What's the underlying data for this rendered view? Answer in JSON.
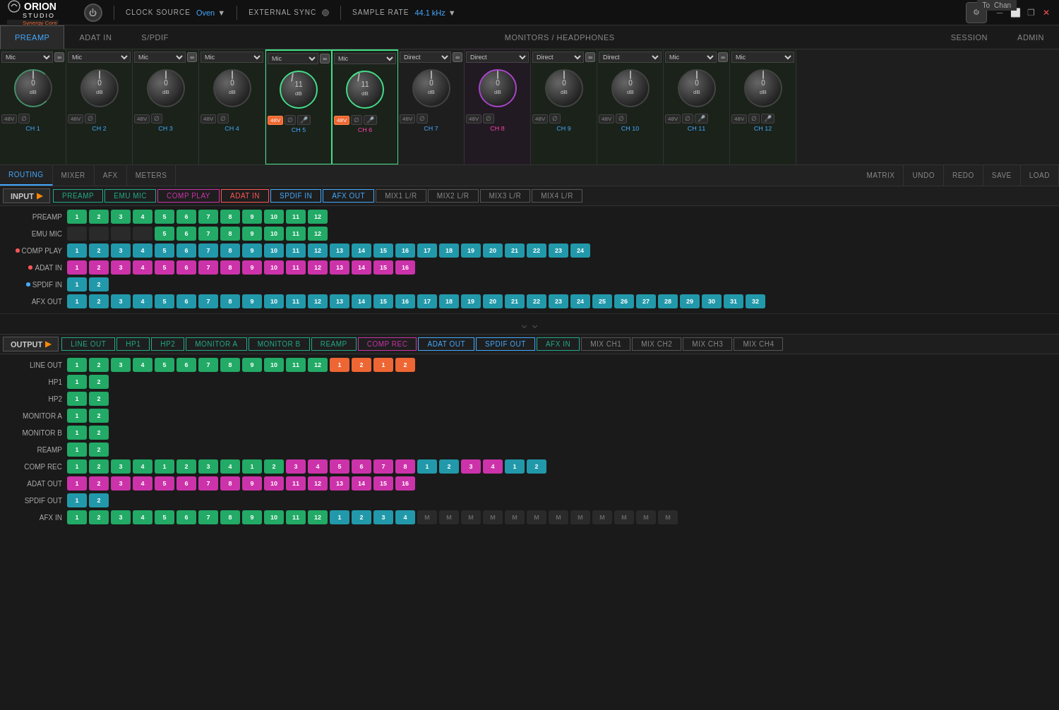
{
  "app": {
    "title": "ORION STUDIO",
    "subtitle": "Synergy Core",
    "power": "⏻",
    "clock_source_label": "CLOCK SOURCE",
    "clock_source_value": "Oven",
    "external_sync_label": "EXTERNAL SYNC",
    "sample_rate_label": "SAMPLE RATE",
    "sample_rate_value": "44.1 kHz"
  },
  "title_tabs": [
    {
      "id": "preamp",
      "label": "PREAMP",
      "active": true
    },
    {
      "id": "adat_in",
      "label": "ADAT IN"
    },
    {
      "id": "spdif",
      "label": "S/PDIF"
    },
    {
      "id": "monitors",
      "label": "MONITORS / HEADPHONES",
      "wide": true
    },
    {
      "id": "session",
      "label": "SESSION"
    },
    {
      "id": "admin",
      "label": "ADMIN"
    }
  ],
  "channels": [
    {
      "id": "ch1",
      "label": "CH 1",
      "type": "input",
      "source": "Mic",
      "db": "0",
      "linked": true,
      "phantom": true,
      "phase": true,
      "color": "green"
    },
    {
      "id": "ch2",
      "label": "CH 2",
      "type": "input",
      "source": "Mic",
      "db": "0",
      "linked": false,
      "phantom": true,
      "phase": true,
      "color": "green"
    },
    {
      "id": "ch3",
      "label": "CH 3",
      "type": "input",
      "source": "Mic",
      "db": "0",
      "linked": true,
      "phantom": true,
      "phase": true,
      "color": "green"
    },
    {
      "id": "ch4",
      "label": "CH 4",
      "type": "input",
      "source": "Mic",
      "db": "0",
      "linked": false,
      "phantom": true,
      "phase": true,
      "color": "green"
    },
    {
      "id": "ch5",
      "label": "CH 5",
      "type": "input",
      "source": "Mic",
      "db": "11",
      "linked": true,
      "phantom": true,
      "phantom_active": true,
      "phase": true,
      "color": "green"
    },
    {
      "id": "ch6",
      "label": "CH 6",
      "type": "input",
      "source": "Mic",
      "db": "11",
      "linked": false,
      "phantom": true,
      "phantom_active": true,
      "phase": true,
      "color": "green"
    },
    {
      "id": "ch7",
      "label": "CH 7",
      "type": "input",
      "source": "Direct",
      "db": "0",
      "linked": true,
      "phantom": true,
      "phase": true,
      "color": "green"
    },
    {
      "id": "ch8",
      "label": "CH 8",
      "type": "input",
      "source": "Direct",
      "db": "0",
      "linked": false,
      "phantom": true,
      "phase": true,
      "color": "pink"
    },
    {
      "id": "ch9",
      "label": "CH 9",
      "type": "input",
      "source": "Direct",
      "db": "0",
      "linked": true,
      "phantom": true,
      "phase": true,
      "color": "green"
    },
    {
      "id": "ch10",
      "label": "CH 10",
      "type": "input",
      "source": "Direct",
      "db": "0",
      "linked": false,
      "phantom": true,
      "phase": true,
      "color": "green"
    },
    {
      "id": "ch11",
      "label": "CH 11",
      "type": "input",
      "source": "Mic",
      "db": "0",
      "linked": true,
      "phantom": true,
      "phase": true,
      "color": "green"
    },
    {
      "id": "ch12",
      "label": "CH 12",
      "type": "input",
      "source": "Mic",
      "db": "0",
      "linked": false,
      "phantom": true,
      "phase": true,
      "color": "green"
    }
  ],
  "nav_tabs": [
    {
      "id": "routing",
      "label": "ROUTING",
      "active": true
    },
    {
      "id": "mixer",
      "label": "MIXER"
    },
    {
      "id": "afx",
      "label": "AFX"
    },
    {
      "id": "meters",
      "label": "METERS"
    }
  ],
  "nav_actions": [
    {
      "id": "matrix",
      "label": "MATRIX"
    },
    {
      "id": "undo",
      "label": "UNDO"
    },
    {
      "id": "redo",
      "label": "REDO"
    },
    {
      "id": "save",
      "label": "SAVE"
    },
    {
      "id": "load",
      "label": "LOAD"
    }
  ],
  "input_label": "INPUT",
  "input_columns": [
    {
      "id": "preamp",
      "label": "PREAMP",
      "color": "green"
    },
    {
      "id": "emu_mic",
      "label": "EMU MIC",
      "color": "green"
    },
    {
      "id": "comp_play",
      "label": "COMP PLAY",
      "color": "pink"
    },
    {
      "id": "adat_in",
      "label": "ADAT IN",
      "color": "red"
    },
    {
      "id": "spdif_in",
      "label": "SPDIF IN",
      "color": "cyan"
    },
    {
      "id": "afx_out",
      "label": "AFX OUT",
      "color": "cyan"
    },
    {
      "id": "mix1lr",
      "label": "MIX1 L/R",
      "color": "gray"
    },
    {
      "id": "mix2lr",
      "label": "MIX2 L/R",
      "color": "gray"
    },
    {
      "id": "mix3lr",
      "label": "MIX3 L/R",
      "color": "gray"
    },
    {
      "id": "mix4lr",
      "label": "MIX4 L/R",
      "color": "gray"
    }
  ],
  "input_rows": [
    {
      "label": "PREAMP",
      "has_dot": false,
      "groups": [
        {
          "color": "green",
          "cells": [
            1,
            2,
            3,
            4,
            5,
            6,
            7,
            8,
            9,
            10,
            11,
            12
          ]
        }
      ]
    },
    {
      "label": "EMU MIC",
      "has_dot": false,
      "groups": [
        {
          "color": "none",
          "cells": [
            null,
            null,
            null,
            null
          ]
        },
        {
          "color": "green",
          "cells": [
            5,
            6,
            7,
            8,
            9,
            10,
            11,
            12
          ]
        }
      ]
    },
    {
      "label": "COMP PLAY",
      "has_dot": true,
      "dot_color": "red",
      "groups": [
        {
          "color": "cyan",
          "cells": [
            1,
            2,
            3,
            4,
            5,
            6,
            7,
            8,
            9,
            10,
            11,
            12,
            13,
            14,
            15,
            16,
            17,
            18,
            19,
            20,
            21,
            22,
            23,
            24
          ]
        }
      ]
    },
    {
      "label": "ADAT IN",
      "has_dot": true,
      "dot_color": "red",
      "groups": [
        {
          "color": "pink",
          "cells": [
            1,
            2,
            3,
            4,
            5,
            6,
            7,
            8,
            9,
            10,
            11,
            12,
            13,
            14,
            15,
            16
          ]
        }
      ]
    },
    {
      "label": "SPDIF IN",
      "has_dot": true,
      "dot_color": "cyan",
      "groups": [
        {
          "color": "cyan",
          "cells": [
            1,
            2
          ]
        }
      ]
    },
    {
      "label": "AFX OUT",
      "has_dot": false,
      "groups": [
        {
          "color": "cyan",
          "cells": [
            1,
            2,
            3,
            4,
            5,
            6,
            7,
            8,
            9,
            10,
            11,
            12,
            13,
            14,
            15,
            16,
            17,
            18,
            19,
            20,
            21,
            22,
            23,
            24,
            25,
            26,
            27,
            28,
            29,
            30,
            31,
            32
          ]
        }
      ]
    }
  ],
  "output_label": "OUTPUT",
  "output_columns": [
    {
      "id": "line_out",
      "label": "LINE OUT",
      "color": "green"
    },
    {
      "id": "hp1",
      "label": "HP1",
      "color": "green"
    },
    {
      "id": "hp2",
      "label": "HP2",
      "color": "green"
    },
    {
      "id": "monitor_a",
      "label": "MONITOR A",
      "color": "green"
    },
    {
      "id": "monitor_b",
      "label": "MONITOR B",
      "color": "green"
    },
    {
      "id": "reamp",
      "label": "REAMP",
      "color": "green"
    },
    {
      "id": "comp_rec",
      "label": "COMP REC",
      "color": "pink"
    },
    {
      "id": "adat_out",
      "label": "ADAT OUT",
      "color": "cyan"
    },
    {
      "id": "spdif_out",
      "label": "SPDIF OUT",
      "color": "cyan"
    },
    {
      "id": "afx_in",
      "label": "AFX IN",
      "color": "green"
    },
    {
      "id": "mix_ch1",
      "label": "MIX CH1",
      "color": "gray"
    },
    {
      "id": "mix_ch2",
      "label": "MIX CH2",
      "color": "gray"
    },
    {
      "id": "mix_ch3",
      "label": "MIX CH3",
      "color": "gray"
    },
    {
      "id": "mix_ch4",
      "label": "MIX CH4",
      "color": "gray"
    }
  ],
  "output_rows": [
    {
      "label": "LINE OUT",
      "groups": [
        {
          "color": "green",
          "cells": [
            1,
            2,
            3,
            4,
            5,
            6,
            7,
            8,
            9,
            10,
            11,
            12
          ]
        },
        {
          "color": "orange",
          "cells": [
            1,
            2
          ]
        },
        {
          "color": "orange",
          "cells": [
            1,
            2
          ]
        }
      ]
    },
    {
      "label": "HP1",
      "groups": [
        {
          "color": "green",
          "cells": [
            1,
            2
          ]
        }
      ]
    },
    {
      "label": "HP2",
      "groups": [
        {
          "color": "green",
          "cells": [
            1,
            2
          ]
        }
      ]
    },
    {
      "label": "MONITOR A",
      "groups": [
        {
          "color": "green",
          "cells": [
            1,
            2
          ]
        }
      ]
    },
    {
      "label": "MONITOR B",
      "groups": [
        {
          "color": "green",
          "cells": [
            1,
            2
          ]
        }
      ]
    },
    {
      "label": "REAMP",
      "groups": [
        {
          "color": "green",
          "cells": [
            1,
            2
          ]
        }
      ]
    },
    {
      "label": "COMP REC",
      "groups": [
        {
          "color": "green",
          "cells": [
            1,
            2
          ]
        },
        {
          "color": "green",
          "cells": [
            3,
            4
          ]
        },
        {
          "color": "green",
          "cells": [
            1,
            2
          ]
        },
        {
          "color": "green",
          "cells": [
            3,
            4
          ]
        },
        {
          "color": "green",
          "cells": [
            1,
            2
          ]
        },
        {
          "color": "pink",
          "cells": [
            3,
            4,
            5,
            6,
            7,
            8
          ]
        },
        {
          "color": "cyan",
          "cells": [
            1,
            2
          ]
        },
        {
          "color": "pink",
          "cells": [
            3,
            4
          ]
        },
        {
          "color": "cyan",
          "cells": [
            1,
            2
          ]
        }
      ]
    },
    {
      "label": "ADAT OUT",
      "groups": [
        {
          "color": "pink",
          "cells": [
            1,
            2,
            3,
            4,
            5,
            6,
            7,
            8,
            9,
            10,
            11,
            12,
            13,
            14,
            15,
            16
          ]
        }
      ]
    },
    {
      "label": "SPDIF OUT",
      "groups": [
        {
          "color": "cyan",
          "cells": [
            1,
            2
          ]
        }
      ]
    },
    {
      "label": "AFX IN",
      "groups": [
        {
          "color": "green",
          "cells": [
            1,
            2,
            3,
            4,
            5,
            6,
            7,
            8,
            9,
            10,
            11,
            12
          ]
        },
        {
          "color": "cyan",
          "cells": [
            1,
            2,
            3,
            4
          ]
        },
        {
          "color": "gray_m",
          "cells": [
            "M",
            "M",
            "M",
            "M",
            "M",
            "M",
            "M",
            "M",
            "M",
            "M",
            "M",
            "M"
          ]
        }
      ]
    }
  ],
  "chan_label": "Chan",
  "to_label": "To"
}
